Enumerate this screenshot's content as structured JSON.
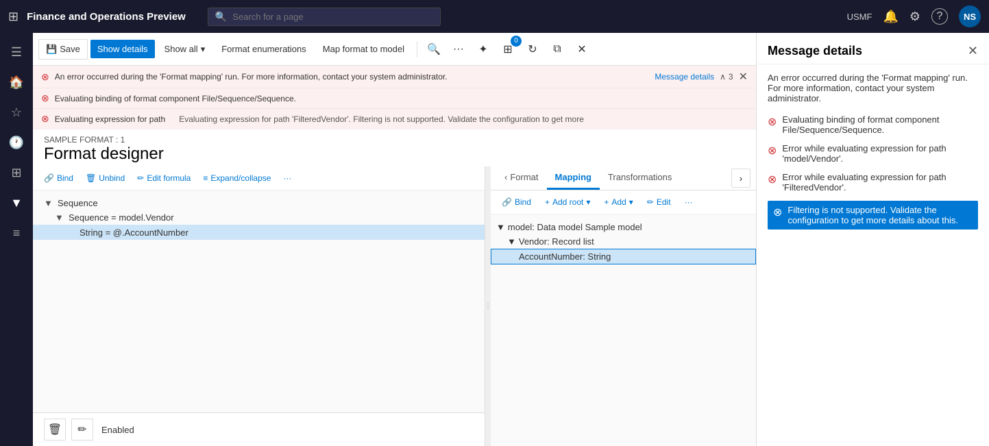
{
  "app": {
    "title": "Finance and Operations Preview",
    "environment": "USMF"
  },
  "search": {
    "placeholder": "Search for a page"
  },
  "toolbar": {
    "save_label": "Save",
    "show_details_label": "Show details",
    "show_all_label": "Show all",
    "format_enumerations_label": "Format enumerations",
    "map_format_label": "Map format to model",
    "badge_count": "0"
  },
  "errors": [
    {
      "text": "An error occurred during the 'Format mapping' run. For more information, contact your system administrator.",
      "has_link": true,
      "link_text": "Message details",
      "count": "3"
    },
    {
      "text": "Evaluating binding of format component File/Sequence/Sequence.",
      "has_link": false
    },
    {
      "text": "Evaluating expression for path",
      "extra": "Evaluating expression for path 'FilteredVendor'. Filtering is not supported. Validate the configuration to get more",
      "has_link": false
    }
  ],
  "designer": {
    "subtitle": "SAMPLE FORMAT : 1",
    "title": "Format designer"
  },
  "designer_toolbar": {
    "bind_label": "Bind",
    "unbind_label": "Unbind",
    "edit_formula_label": "Edit formula",
    "expand_label": "Expand/collapse"
  },
  "tabs": {
    "format_label": "Format",
    "mapping_label": "Mapping",
    "transformations_label": "Transformations"
  },
  "tree": {
    "items": [
      {
        "label": "Sequence",
        "level": 0,
        "toggle": "▼"
      },
      {
        "label": "Sequence = model.Vendor",
        "level": 1,
        "toggle": "▼"
      },
      {
        "label": "String = @.AccountNumber",
        "level": 2,
        "selected": true
      }
    ]
  },
  "model_toolbar": {
    "bind_label": "Bind",
    "add_root_label": "Add root",
    "add_label": "Add",
    "edit_label": "Edit"
  },
  "model_tree": {
    "items": [
      {
        "label": "model: Data model Sample model",
        "level": 0,
        "toggle": "▼"
      },
      {
        "label": "Vendor: Record list",
        "level": 1,
        "toggle": "▼"
      },
      {
        "label": "AccountNumber: String",
        "level": 2,
        "selected": true
      }
    ]
  },
  "bottom": {
    "status_label": "Enabled"
  },
  "message_panel": {
    "title": "Message details",
    "intro": "An error occurred during the 'Format mapping' run. For more information, contact your system administrator.",
    "errors": [
      {
        "text": "Evaluating binding of format component File/Sequence/Sequence.",
        "highlighted": false
      },
      {
        "text": "Error while evaluating expression for path 'model/Vendor'.",
        "highlighted": false
      },
      {
        "text": "Error while evaluating expression for path 'FilteredVendor'.",
        "highlighted": false
      },
      {
        "text": "Filtering is not supported. Validate the configuration to get more details about this.",
        "highlighted": true
      }
    ]
  },
  "icons": {
    "grid": "⊞",
    "bell": "🔔",
    "gear": "⚙",
    "question": "?",
    "search": "🔍",
    "save": "💾",
    "chevron_down": "▾",
    "error_circle": "⊗",
    "bind": "🔗",
    "unbind": "🗑",
    "edit": "✏",
    "expand": "≡",
    "more": "···",
    "chevron_left": "‹",
    "chevron_right": "›",
    "add": "+",
    "close": "✕",
    "collapse": "▲",
    "up_arrow": "∧",
    "delete": "🗑",
    "pencil": "✏",
    "refresh": "↻",
    "open": "⧉",
    "stop": "⛔"
  }
}
